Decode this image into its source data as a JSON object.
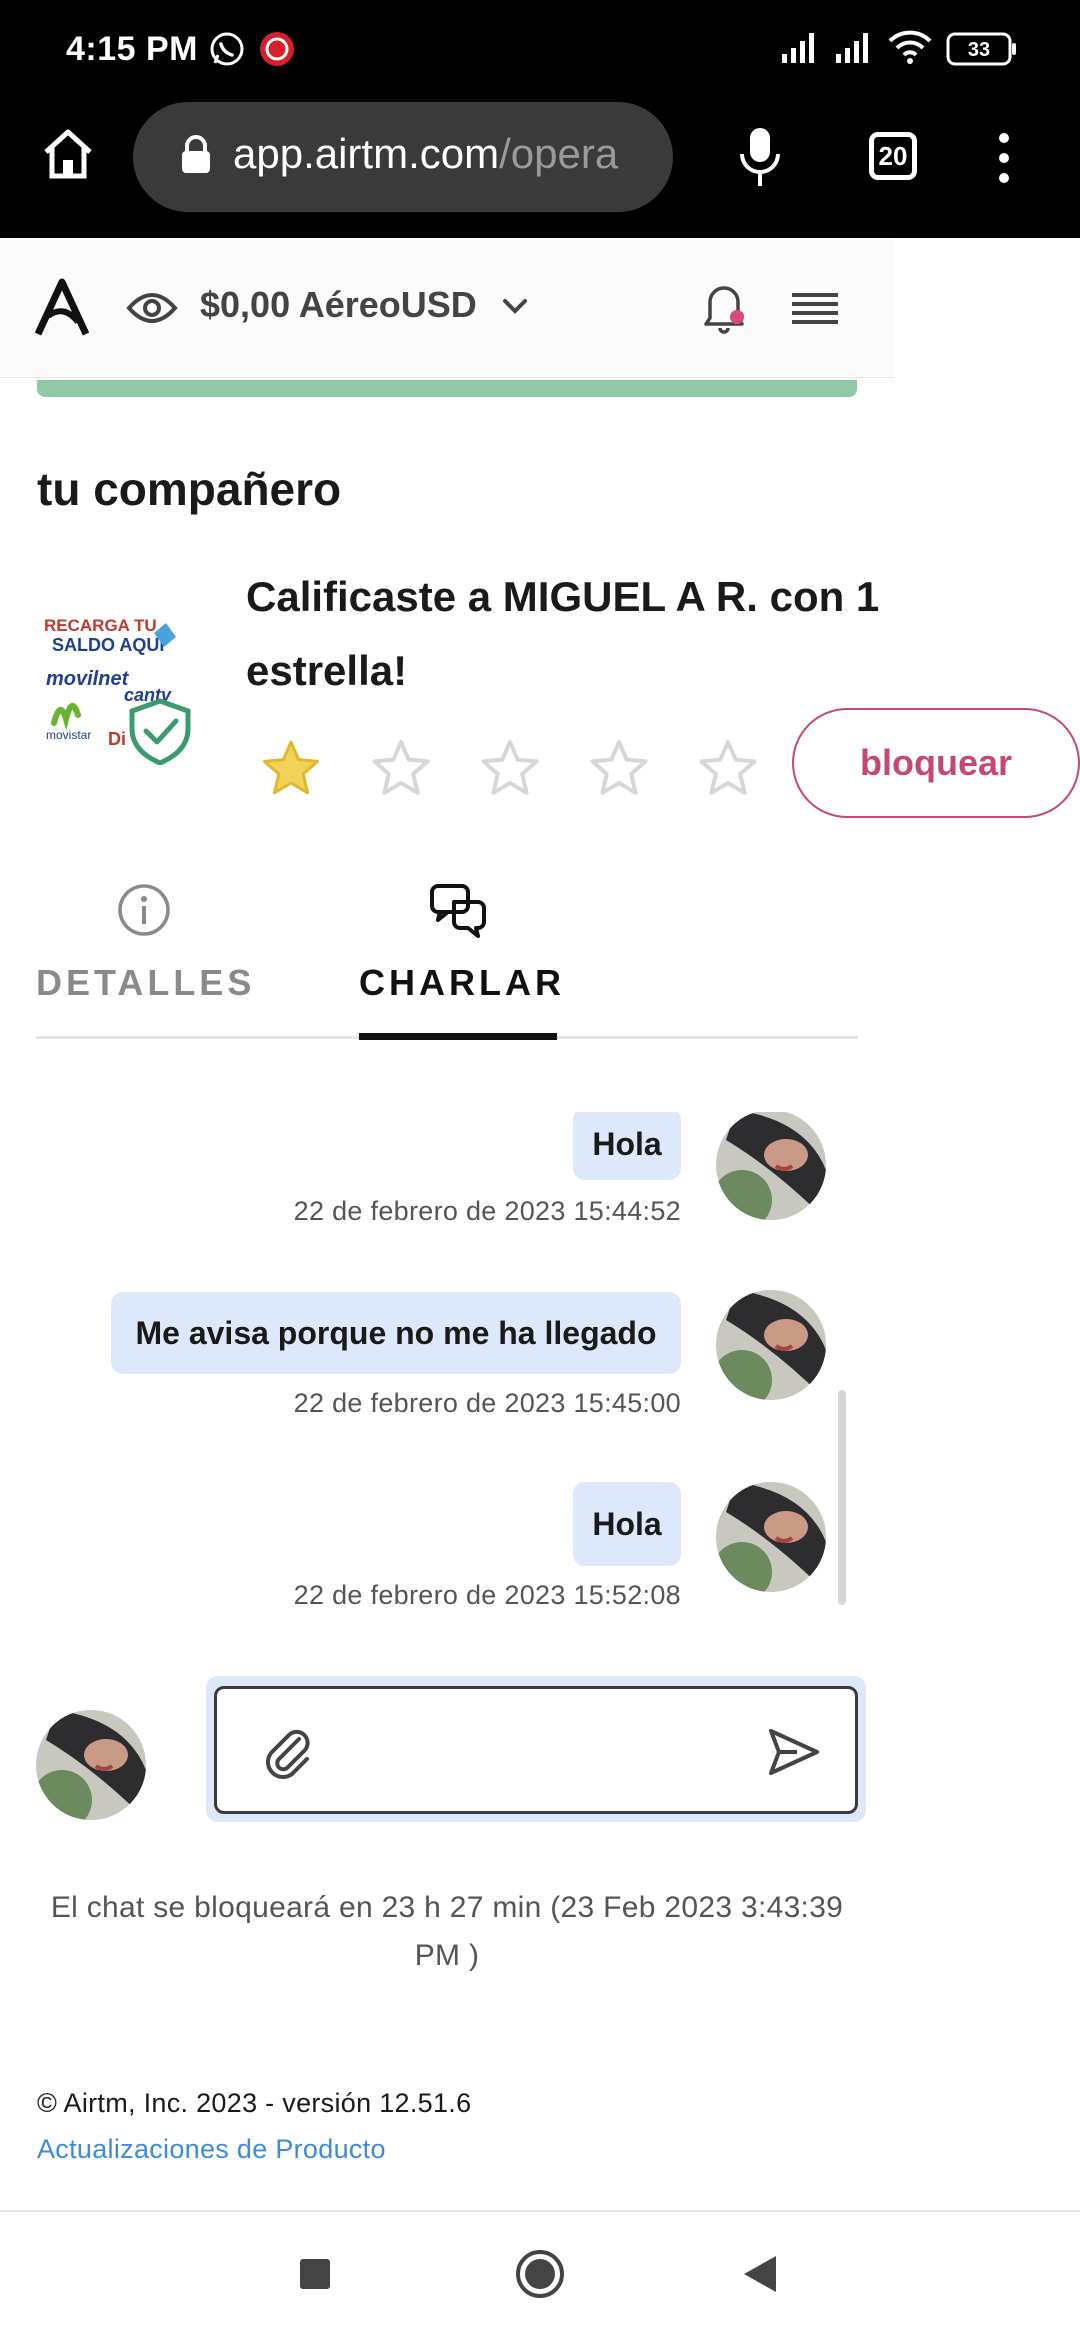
{
  "status_bar": {
    "time": "4:15 PM",
    "battery": "33",
    "icons": [
      "whatsapp-icon",
      "app-notification-icon",
      "signal-icon",
      "signal-icon",
      "wifi-icon",
      "battery-icon"
    ]
  },
  "browser": {
    "url_host": "app.airtm.com",
    "url_path": "/opera",
    "tabs_count": "20",
    "icons": [
      "home-icon",
      "lock-icon",
      "microphone-icon",
      "tabs-icon",
      "more-vertical-icon"
    ]
  },
  "app_header": {
    "balance": "$0,00 AéreoUSD",
    "icons": [
      "airtm-logo",
      "eye-icon",
      "chevron-down-icon",
      "bell-icon",
      "menu-icon"
    ],
    "notification_color": "#d94a7a"
  },
  "partner": {
    "section_title": "tu compañero",
    "logo_text": [
      "RECARGA TU",
      "SALDO AQUÍ",
      "movilnet",
      "cantv",
      "movistar",
      "Di"
    ],
    "rating_message": "Calificaste a MIGUEL A R. con 1 estrella!",
    "rating": 1,
    "rating_max": 5,
    "block_label": "bloquear"
  },
  "tabs": [
    {
      "label": "DETALLES",
      "icon": "info-icon",
      "active": false
    },
    {
      "label": "CHARLAR",
      "icon": "chat-bubbles-icon",
      "active": true
    }
  ],
  "messages": [
    {
      "text": "Hola",
      "time": "22 de febrero de 2023 15:44:52"
    },
    {
      "text": "Me avisa porque no me ha llegado",
      "time": "22 de febrero de 2023 15:45:00"
    },
    {
      "text": "Hola",
      "time": "22 de febrero de 2023 15:52:08"
    }
  ],
  "composer": {
    "placeholder": "",
    "icons": [
      "paperclip-icon",
      "send-icon"
    ]
  },
  "chat_lock_note": "El chat se bloqueará en 23 h 27 min (23 Feb 2023 3:43:39 PM )",
  "footer": {
    "copyright": "© Airtm, Inc. 2023 - versión 12.51.6",
    "product_updates": "Actualizaciones de Producto"
  },
  "colors": {
    "accent_pink": "#c64872",
    "bubble_blue": "#dde9fb",
    "link_blue": "#3d8bd9",
    "success_green": "#8fc9a8",
    "star_gold": "#f3d25a"
  }
}
